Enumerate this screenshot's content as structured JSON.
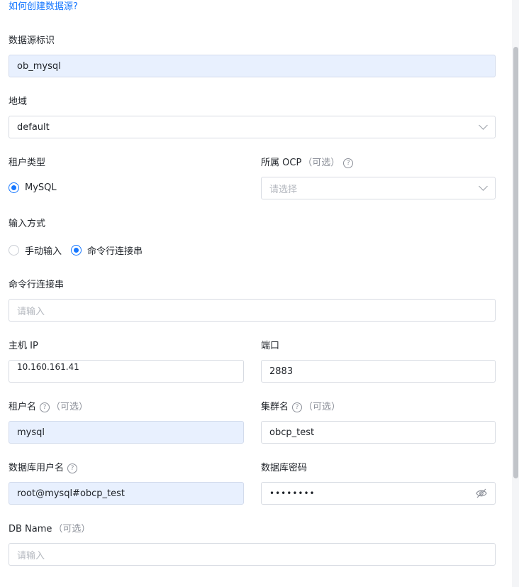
{
  "help_link": "如何创建数据源?",
  "datasource_id": {
    "label": "数据源标识",
    "value": "ob_mysql"
  },
  "region": {
    "label": "地域",
    "value": "default"
  },
  "tenant_type": {
    "label": "租户类型",
    "option": "MySQL"
  },
  "ocp": {
    "label": "所属 OCP",
    "optional": "（可选）",
    "placeholder": "请选择"
  },
  "input_method": {
    "label": "输入方式",
    "options": [
      "手动输入",
      "命令行连接串"
    ],
    "selected": "命令行连接串"
  },
  "cmd_string": {
    "label": "命令行连接串",
    "placeholder": "请输入"
  },
  "host_ip": {
    "label": "主机 IP",
    "value": "10.160.161.41"
  },
  "port": {
    "label": "端口",
    "value": "2883"
  },
  "tenant_name": {
    "label": "租户名",
    "optional": "（可选）",
    "value": "mysql"
  },
  "cluster_name": {
    "label": "集群名",
    "optional": "（可选）",
    "value": "obcp_test"
  },
  "db_username": {
    "label": "数据库用户名",
    "value": "root@mysql#obcp_test"
  },
  "db_password": {
    "label": "数据库密码",
    "value": "••••••••"
  },
  "db_name": {
    "label": "DB Name",
    "optional": "（可选）",
    "placeholder": "请输入"
  },
  "colors": {
    "accent": "#1677ff",
    "filled_bg": "#e8f0fe",
    "border": "#d7dbe2"
  }
}
